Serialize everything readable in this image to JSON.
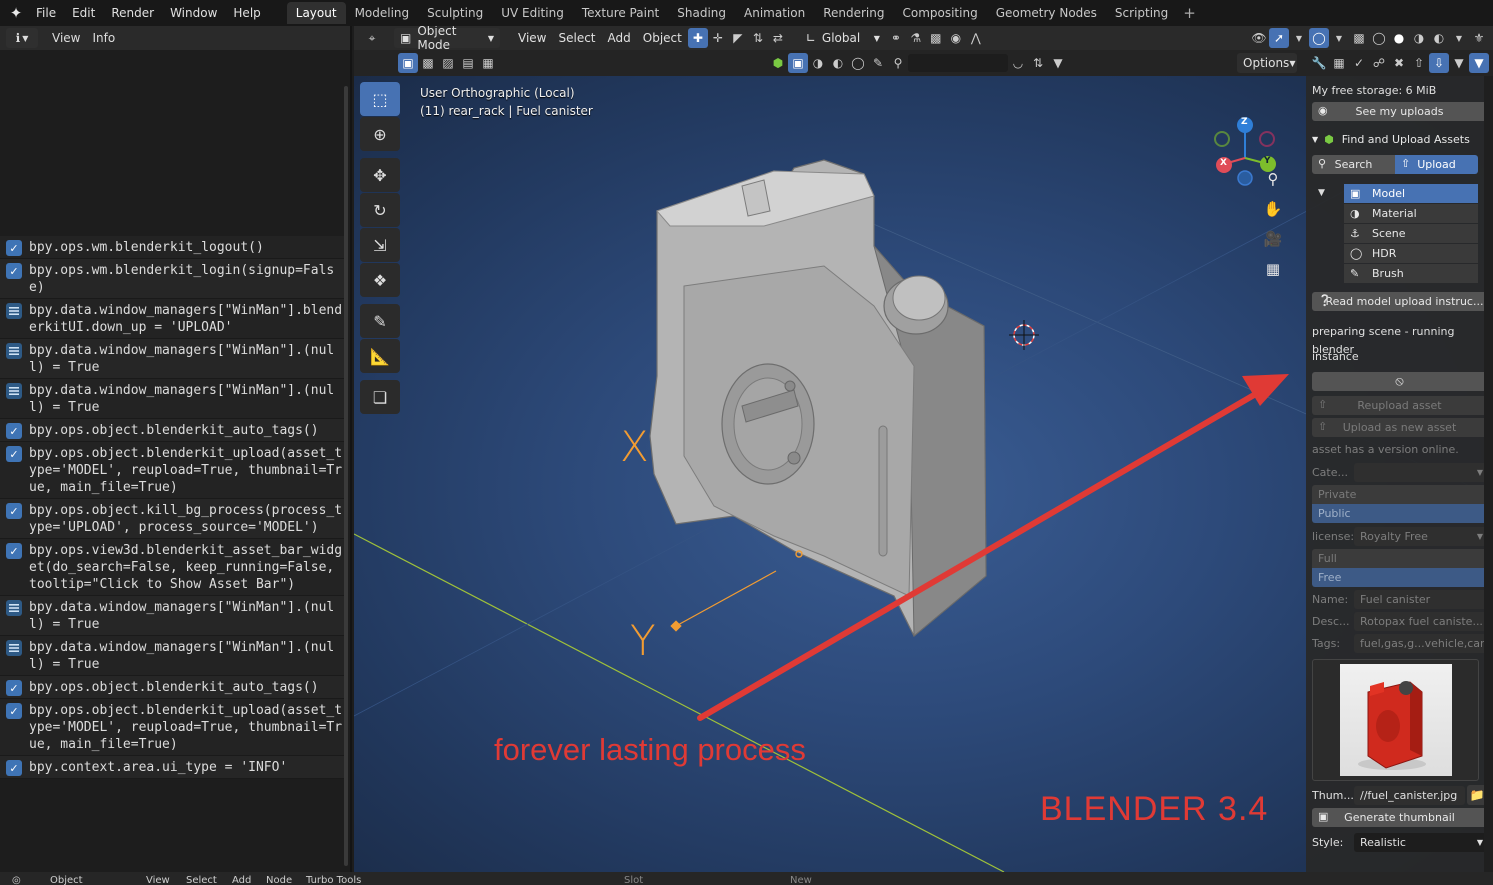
{
  "menu": [
    "File",
    "Edit",
    "Render",
    "Window",
    "Help"
  ],
  "workspaces": [
    "Layout",
    "Modeling",
    "Sculpting",
    "UV Editing",
    "Texture Paint",
    "Shading",
    "Animation",
    "Rendering",
    "Compositing",
    "Geometry Nodes",
    "Scripting"
  ],
  "info_header": {
    "view": "View",
    "info": "Info"
  },
  "info_log": [
    {
      "icon": "check",
      "text": "bpy.ops.wm.blenderkit_logout()"
    },
    {
      "icon": "check",
      "text": "bpy.ops.wm.blenderkit_login(signup=False)"
    },
    {
      "icon": "prop",
      "text": "bpy.data.window_managers[\"WinMan\"].blenderkitUI.down_up = 'UPLOAD'"
    },
    {
      "icon": "prop",
      "text": "bpy.data.window_managers[\"WinMan\"].(null) = True"
    },
    {
      "icon": "prop",
      "text": "bpy.data.window_managers[\"WinMan\"].(null) = True"
    },
    {
      "icon": "check",
      "text": "bpy.ops.object.blenderkit_auto_tags()"
    },
    {
      "icon": "check",
      "text": "bpy.ops.object.blenderkit_upload(asset_type='MODEL', reupload=True, thumbnail=True, main_file=True)"
    },
    {
      "icon": "check",
      "text": "bpy.ops.object.kill_bg_process(process_type='UPLOAD', process_source='MODEL')"
    },
    {
      "icon": "check",
      "text": "bpy.ops.view3d.blenderkit_asset_bar_widget(do_search=False, keep_running=False, tooltip=\"Click to Show Asset Bar\")"
    },
    {
      "icon": "prop",
      "text": "bpy.data.window_managers[\"WinMan\"].(null) = True"
    },
    {
      "icon": "prop",
      "text": "bpy.data.window_managers[\"WinMan\"].(null) = True"
    },
    {
      "icon": "check",
      "text": "bpy.ops.object.blenderkit_auto_tags()"
    },
    {
      "icon": "check",
      "text": "bpy.ops.object.blenderkit_upload(asset_type='MODEL', reupload=True, thumbnail=True, main_file=True)"
    },
    {
      "icon": "check",
      "text": "bpy.context.area.ui_type = 'INFO'"
    }
  ],
  "viewport_header": {
    "mode": "Object Mode",
    "menus": [
      "View",
      "Select",
      "Add",
      "Object"
    ],
    "orientation": "Global",
    "options": "Options"
  },
  "viewport_overlay": {
    "view_name": "User Orthographic (Local)",
    "object_info": "(11) rear_rack | Fuel canister"
  },
  "gizmo_axes": {
    "z": "Z",
    "y": "Y",
    "x": "X"
  },
  "axis_labels": {
    "x": "X",
    "y": "Y"
  },
  "annotations": {
    "process": "forever lasting process",
    "version": "BLENDER 3.4"
  },
  "colors": {
    "accent": "#4772b3",
    "annotation": "#e03a35",
    "axis_x": "#e04c58",
    "axis_y": "#7dbd2c",
    "axis_z": "#2f7fd8",
    "origin": "#f29c32"
  },
  "blenderkit": {
    "storage": "My free storage: 6 MiB",
    "see_uploads": "See my uploads",
    "section_title": "Find and Upload Assets",
    "search_tab": "Search",
    "upload_tab": "Upload",
    "asset_types": [
      {
        "label": "Model",
        "icon": "cube-icon",
        "selected": true
      },
      {
        "label": "Material",
        "icon": "material-icon",
        "selected": false
      },
      {
        "label": "Scene",
        "icon": "scene-icon",
        "selected": false
      },
      {
        "label": "HDR",
        "icon": "world-icon",
        "selected": false
      },
      {
        "label": "Brush",
        "icon": "brush-icon",
        "selected": false
      }
    ],
    "read_instructions": "Read model upload instruc...",
    "status_line1": "preparing scene - running blender",
    "status_line2": "instance",
    "reupload": "Reupload asset",
    "upload_new": "Upload as new asset",
    "version_note": "asset has a version online.",
    "category_label": "Cate...",
    "private": "Private",
    "public": "Public",
    "license_label": "license:",
    "license_value": "Royalty Free",
    "full": "Full",
    "free": "Free",
    "name_label": "Name:",
    "name_value": "Fuel canister",
    "desc_label": "Desc...",
    "desc_value": "Rotopax fuel caniste...",
    "tags_label": "Tags:",
    "tags_value": "fuel,gas,g...vehicle,car",
    "thumb_label": "Thum...",
    "thumb_value": "//fuel_canister.jpg",
    "generate_thumbnail": "Generate thumbnail",
    "style_label": "Style:",
    "style_value": "Realistic"
  },
  "bottom_bar": {
    "mode": "Object",
    "menus": [
      "View",
      "Select",
      "Add",
      "Node",
      "Turbo Tools"
    ],
    "slot": "Slot",
    "new": "New"
  }
}
